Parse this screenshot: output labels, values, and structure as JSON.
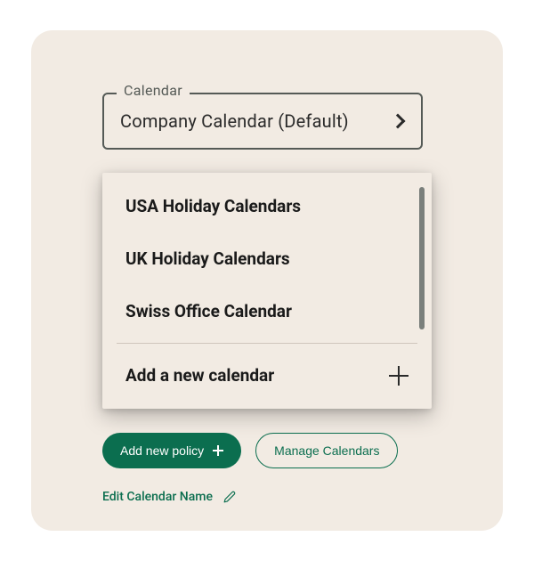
{
  "select": {
    "label": "Calendar",
    "value": "Company Calendar (Default)"
  },
  "dropdown": {
    "items": [
      {
        "label": "USA Holiday Calendars"
      },
      {
        "label": "UK Holiday Calendars"
      },
      {
        "label": "Swiss Office Calendar"
      }
    ],
    "addLabel": "Add a new calendar"
  },
  "buttons": {
    "addPolicy": "Add new policy",
    "manageCalendars": "Manage Calendars"
  },
  "editLink": "Edit Calendar Name",
  "colors": {
    "primary": "#0b6e4f",
    "surface": "#F2EBE3"
  }
}
